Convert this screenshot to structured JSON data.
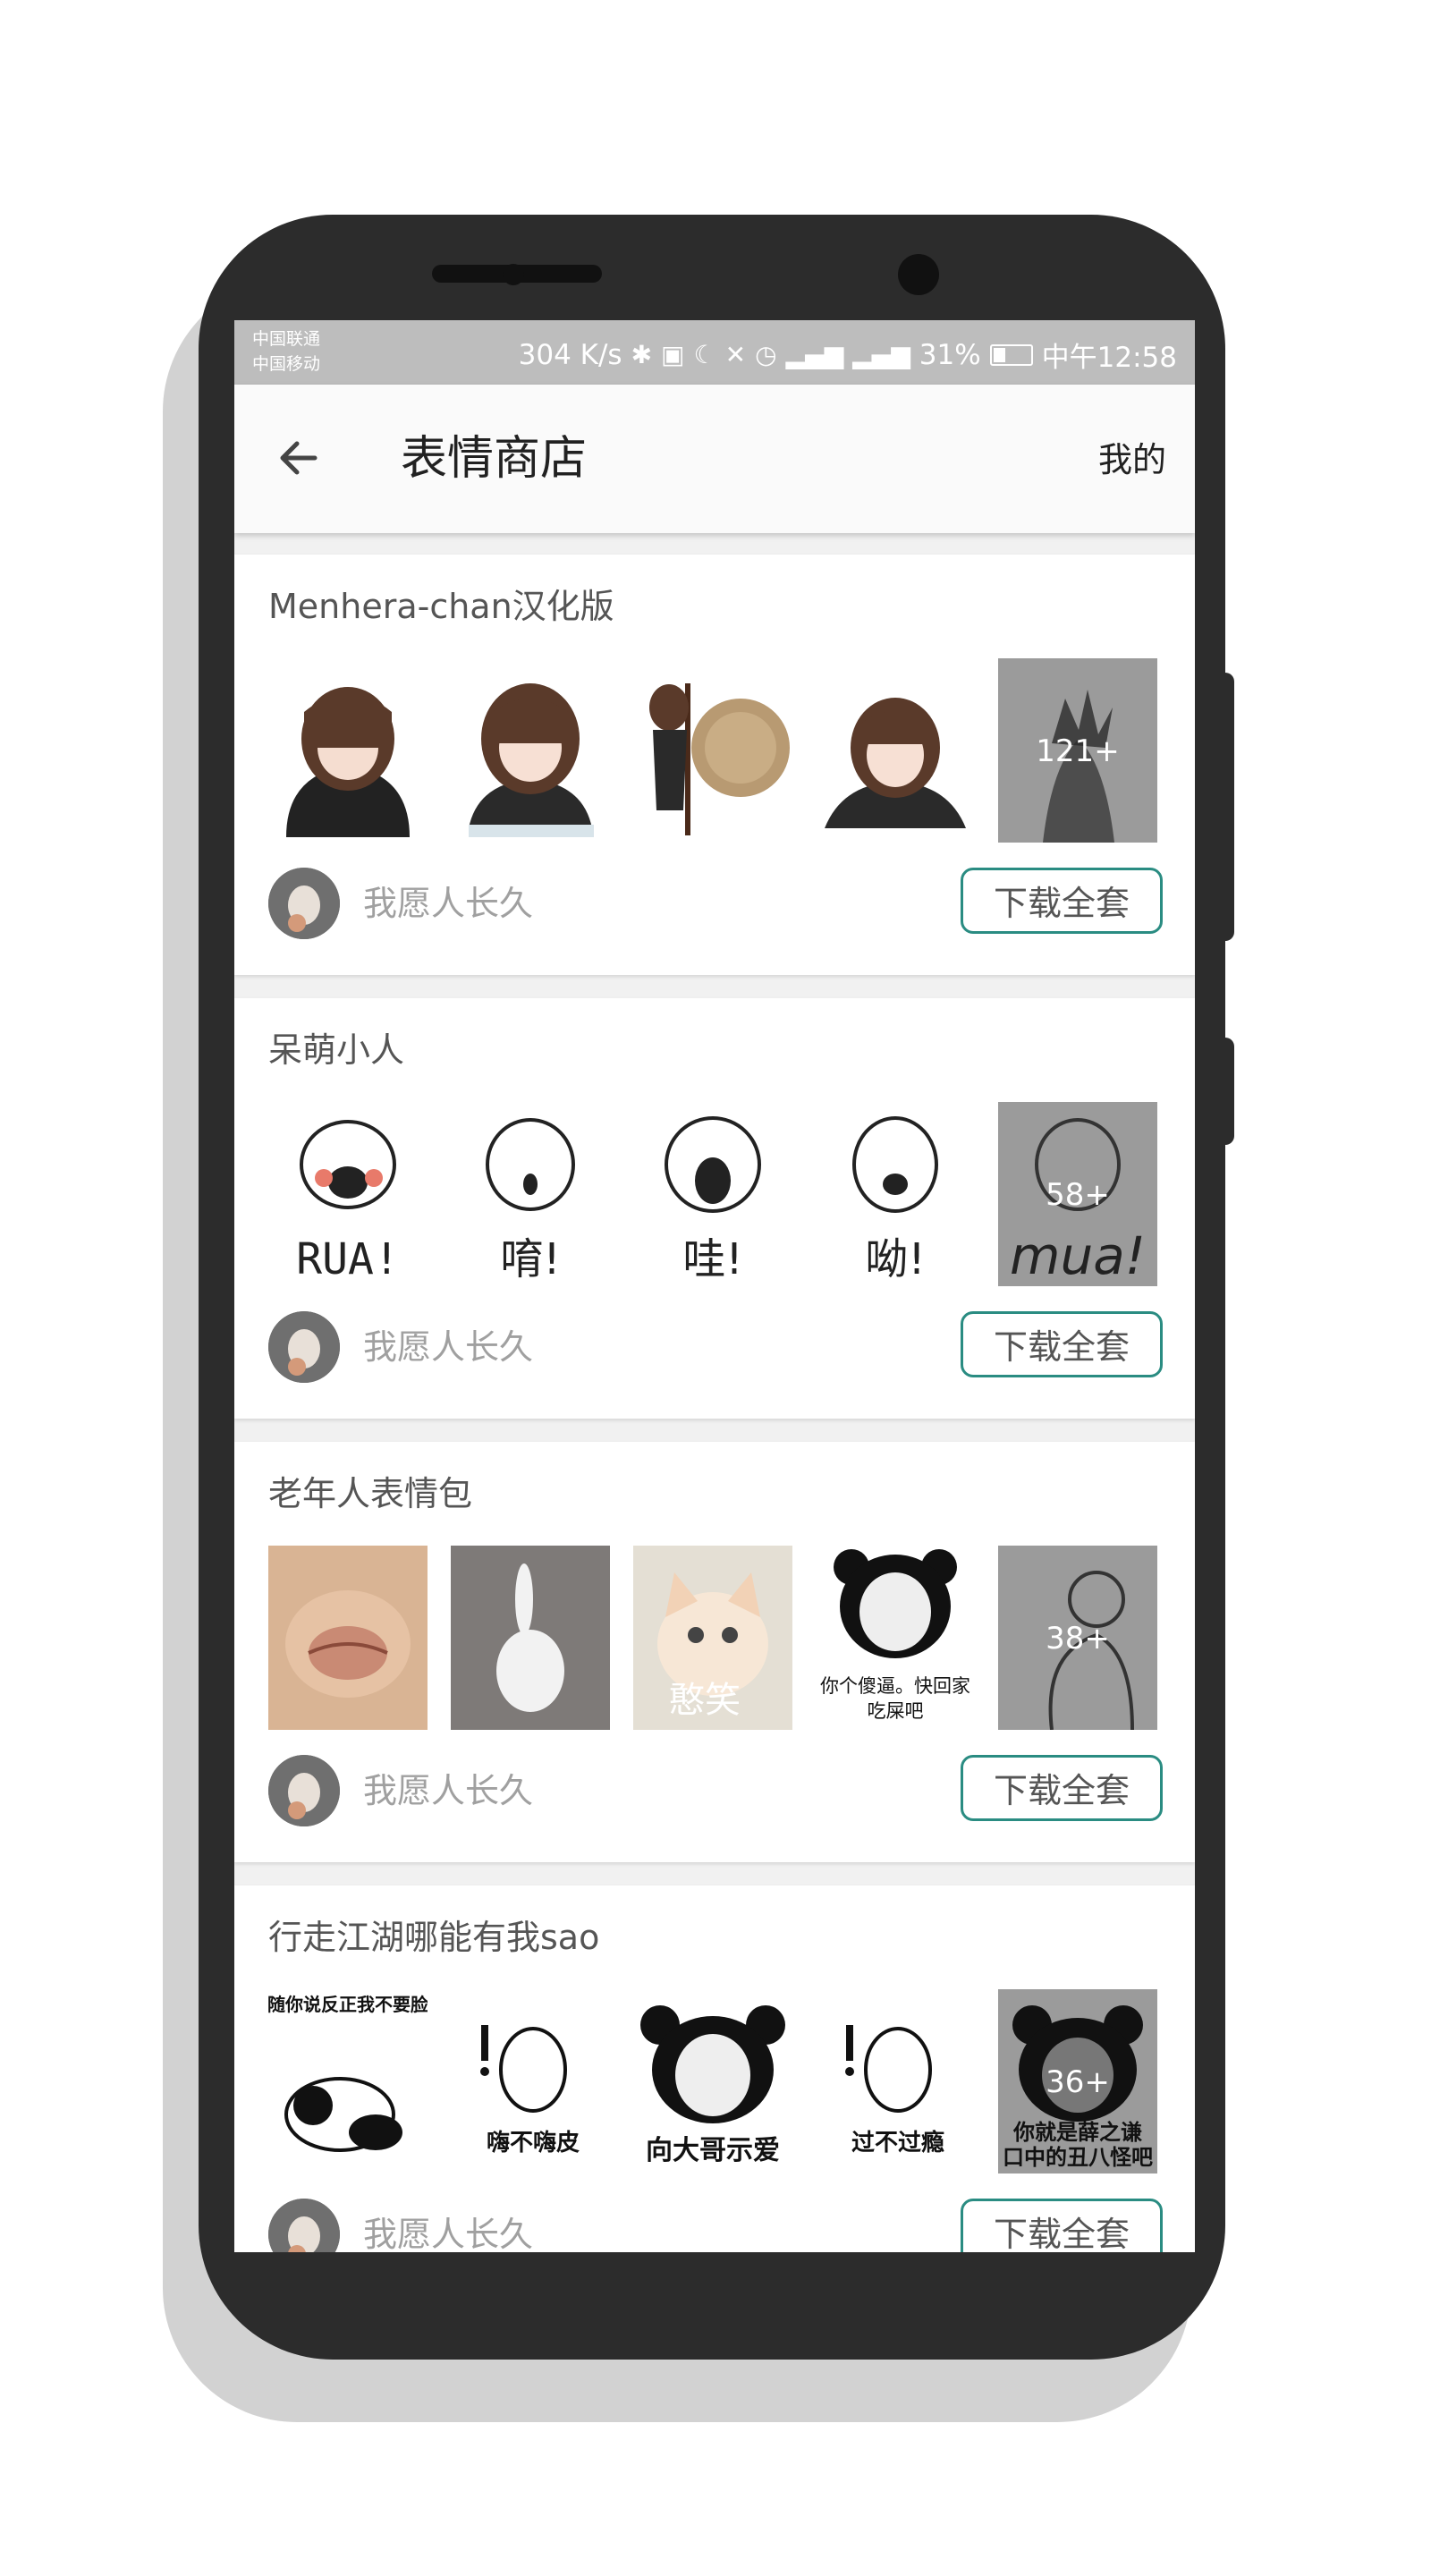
{
  "status_bar": {
    "carrier_1": "中国联通",
    "carrier_2": "中国移动",
    "speed": "304 K/s",
    "battery": "31%",
    "time": "中午12:58"
  },
  "app_bar": {
    "back_icon": "arrow-left-icon",
    "title": "表情商店",
    "mine": "我的"
  },
  "packs": [
    {
      "title": "Menhera-chan汉化版",
      "more": "121+",
      "author": "我愿人长久",
      "download": "下载全套"
    },
    {
      "title": "呆萌小人",
      "more": "58+",
      "author": "我愿人长久",
      "download": "下载全套",
      "captions": [
        "RUA!",
        "唷!",
        "哇!",
        "呦!",
        "mua!"
      ]
    },
    {
      "title": "老年人表情包",
      "more": "38+",
      "author": "我愿人长久",
      "download": "下载全套",
      "captions": [
        "憨笑",
        "你个傻逼。快回家",
        "吃屎吧"
      ]
    },
    {
      "title": "行走江湖哪能有我sao",
      "more": "36+",
      "author": "我愿人长久",
      "download": "下载全套",
      "captions": [
        "随你说反正我不要脸",
        "嗨不嗨皮",
        "向大哥示爱",
        "过不过瘾",
        "你就是薛之谦",
        "口中的丑八怪吧"
      ]
    }
  ],
  "colors": {
    "accent": "#2a8c82",
    "status_bar": "#bdbdbd",
    "phone": "#2c2c2c"
  }
}
